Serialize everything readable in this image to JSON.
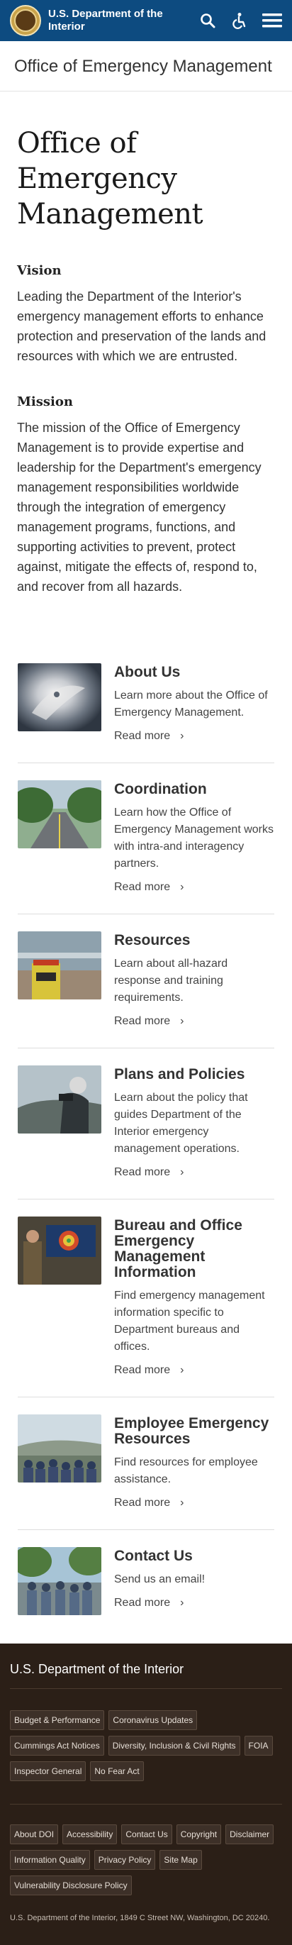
{
  "header": {
    "site_name": "U.S. Department of the Interior",
    "logo_icon": "doi-seal-icon",
    "search_icon": "search-icon",
    "accessibility_icon": "accessibility-icon",
    "menu_icon": "menu-icon",
    "background_color": "#0d4b80"
  },
  "section_title": "Office of Emergency Management",
  "page_title": "Office of Emergency Management",
  "vision": {
    "heading": "Vision",
    "text": "Leading the Department of the Interior's emergency management efforts to enhance protection and preservation of the lands and resources with which we are entrusted."
  },
  "mission": {
    "heading": "Mission",
    "text": "The mission of the Office of Emergency Management is to provide expertise and leadership for the Department's emergency management responsibilities worldwide through the integration of emergency management programs, functions, and supporting activities to prevent, protect against, mitigate the effects of, respond to, and recover from all hazards."
  },
  "cards": [
    {
      "title": "About Us",
      "desc": "Learn more about the Office of Emergency Management.",
      "link": "Read more"
    },
    {
      "title": "Coordination",
      "desc": "Learn how the Office of Emergency Management works with intra-and interagency partners.",
      "link": "Read more"
    },
    {
      "title": "Resources",
      "desc": "Learn about all-hazard response and training requirements.",
      "link": "Read more"
    },
    {
      "title": "Plans and Policies",
      "desc": "Learn about the policy that guides Department of the Interior emergency management operations.",
      "link": "Read more"
    },
    {
      "title": "Bureau and Office Emergency Management Information",
      "desc": "Find emergency management information specific to Department bureaus and offices.",
      "link": "Read more"
    },
    {
      "title": "Employee Emergency Resources",
      "desc": "Find resources for employee assistance.",
      "link": "Read more"
    },
    {
      "title": "Contact Us",
      "desc": "Send us an email!",
      "link": "Read more"
    }
  ],
  "footer": {
    "brand": "U.S. Department of the Interior",
    "links_primary": [
      "Budget & Performance",
      "Coronavirus Updates",
      "Cummings Act Notices",
      "Diversity, Inclusion & Civil Rights",
      "FOIA",
      "Inspector General",
      "No Fear Act"
    ],
    "links_secondary": [
      "About DOI",
      "Accessibility",
      "Contact Us",
      "Copyright",
      "Disclaimer",
      "Information Quality",
      "Privacy Policy",
      "Site Map",
      "Vulnerability Disclosure Policy"
    ],
    "address": "U.S. Department of the Interior, 1849 C Street NW, Washington, DC 20240.",
    "background_color": "#2b1f17"
  }
}
